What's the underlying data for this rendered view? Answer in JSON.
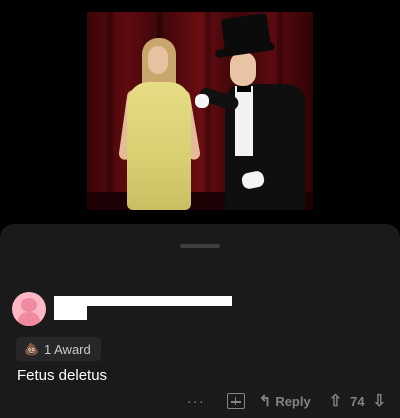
{
  "comment": {
    "award_icon": "poop-award-icon",
    "award_label": "1 Award",
    "body": "Fetus deletus",
    "more_label": "···",
    "reply_label": "Reply",
    "vote_count": "74"
  }
}
